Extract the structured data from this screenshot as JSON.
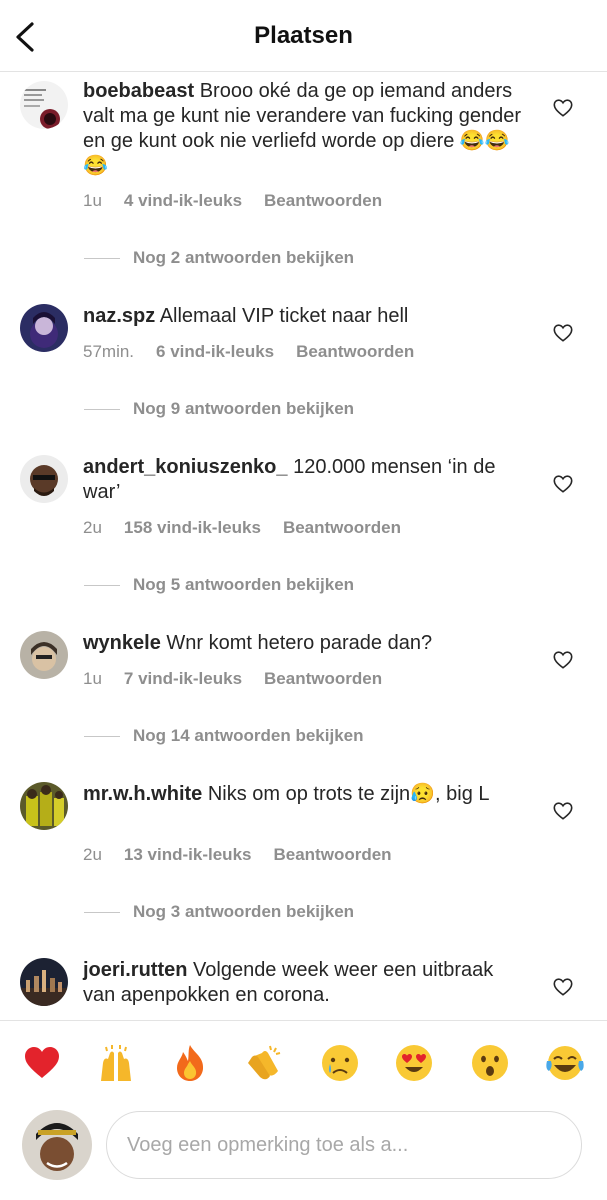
{
  "header": {
    "title": "Plaatsen",
    "back_icon": "chevron-left-icon"
  },
  "comments": [
    {
      "username": "boebabeast",
      "text": "Brooo oké da ge op iemand anders valt ma ge kunt nie verandere van fucking gender en ge kunt ook nie verliefd worde op diere 😂😂😂",
      "time": "1u",
      "likes": "4 vind-ik-leuks",
      "reply": "Beantwoorden",
      "more_replies": "Nog 2 antwoorden bekijken"
    },
    {
      "username": "naz.spz",
      "text": "Allemaal VIP ticket naar hell",
      "time": "57min.",
      "likes": "6 vind-ik-leuks",
      "reply": "Beantwoorden",
      "more_replies": "Nog 9 antwoorden bekijken"
    },
    {
      "username": "andert_koniuszenko_",
      "text": "120.000 mensen ‘in de war’",
      "time": "2u",
      "likes": "158 vind-ik-leuks",
      "reply": "Beantwoorden",
      "more_replies": "Nog 5 antwoorden bekijken"
    },
    {
      "username": "wynkele",
      "text": "Wnr komt hetero parade dan?",
      "time": "1u",
      "likes": "7 vind-ik-leuks",
      "reply": "Beantwoorden",
      "more_replies": "Nog 14 antwoorden bekijken"
    },
    {
      "username": "mr.w.h.white",
      "text": "Niks om op trots te zijn😥, big L",
      "time": "2u",
      "likes": "13 vind-ik-leuks",
      "reply": "Beantwoorden",
      "more_replies": "Nog 3 antwoorden bekijken"
    },
    {
      "username": "joeri.rutten",
      "text": "Volgende week weer een uitbraak van apenpokken en corona."
    }
  ],
  "emoji_bar": [
    "red-heart",
    "raising-hands",
    "fire",
    "clapping-hands",
    "crying-face",
    "heart-eyes-face",
    "astonished-face",
    "tears-of-joy-face"
  ],
  "composer": {
    "placeholder": "Voeg een opmerking toe als a..."
  },
  "colors": {
    "meta_text": "#8e8e8e",
    "primary_text": "#262626",
    "divider": "#e3e3e3"
  }
}
